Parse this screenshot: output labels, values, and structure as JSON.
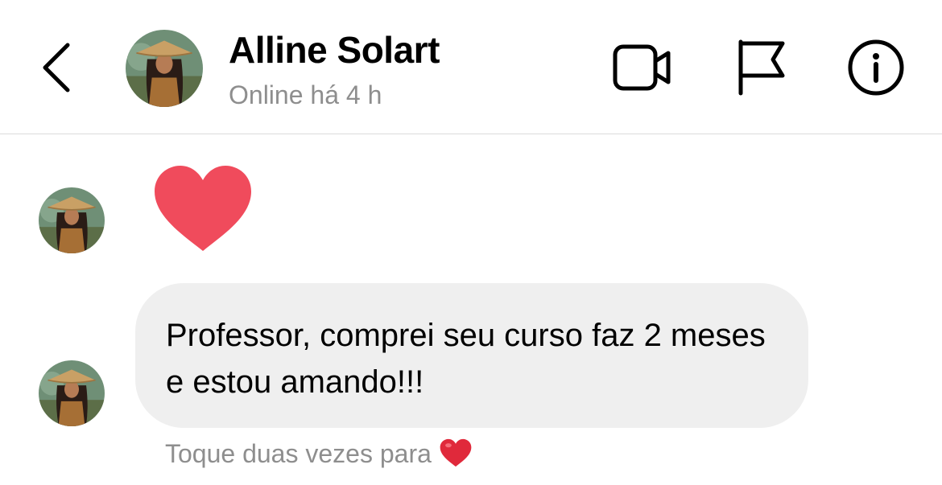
{
  "header": {
    "contact_name": "Alline Solart",
    "status": "Online há 4 h",
    "icons": [
      "back-arrow-icon",
      "video-camera-icon",
      "flag-icon",
      "info-icon"
    ]
  },
  "messages": [
    {
      "type": "reaction",
      "content": "heart",
      "color": "#f04b5c"
    },
    {
      "type": "text",
      "text": "Professor, comprei seu curso faz 2 meses e estou amando!!!"
    }
  ],
  "hint": {
    "text": "Toque duas vezes para",
    "emoji": "❤️"
  },
  "colors": {
    "heart": "#f04b5c",
    "bubble": "#efefef",
    "secondary_text": "#8e8e8e",
    "divider": "#dcdcdc"
  }
}
